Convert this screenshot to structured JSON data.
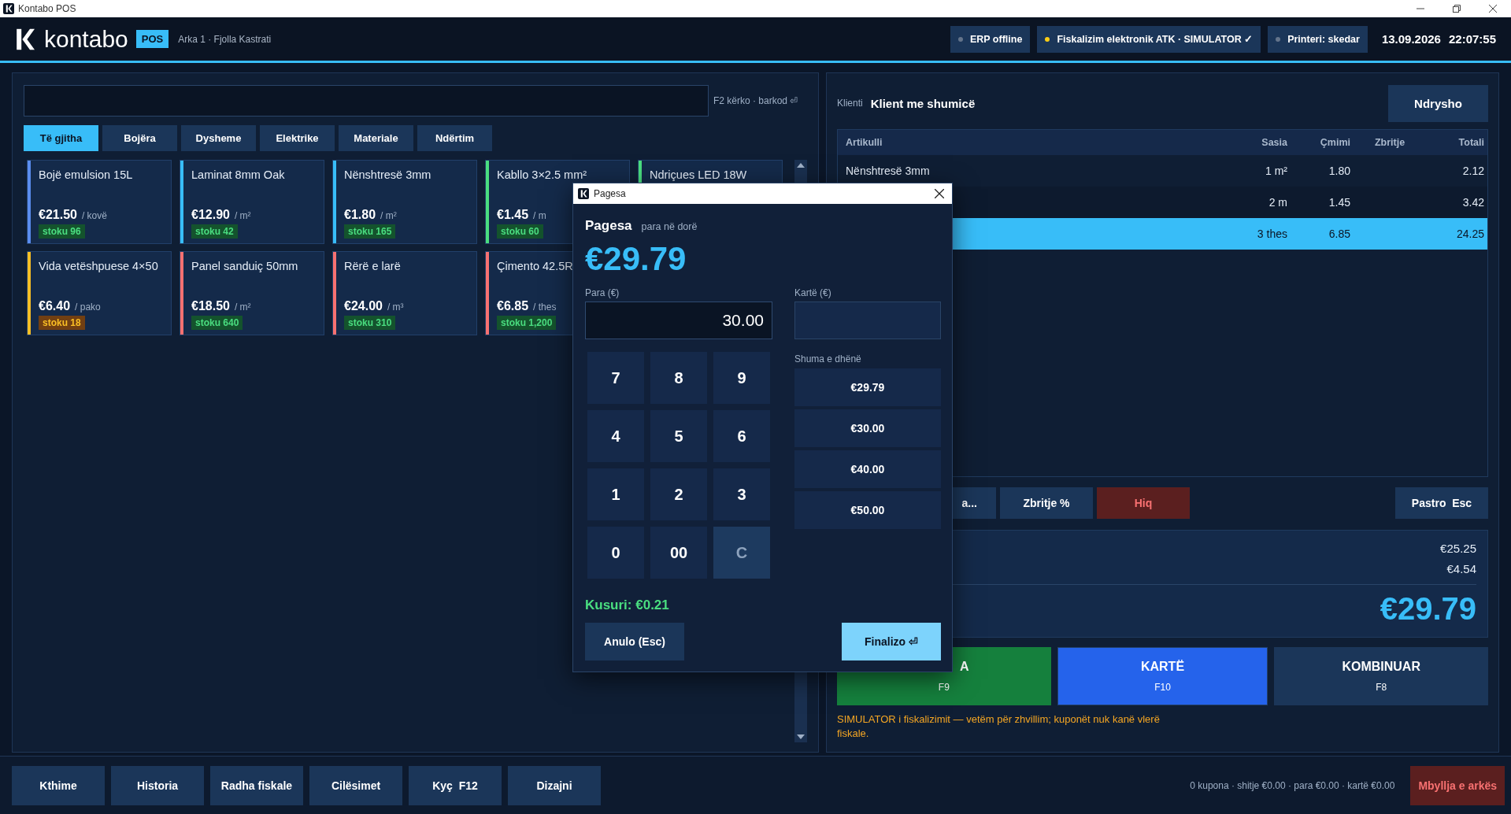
{
  "window": {
    "title": "Kontabo POS"
  },
  "header": {
    "logo": "kontabo",
    "badge": "POS",
    "register": "Arka 1 · Fjolla Kastrati",
    "status": [
      {
        "label": "ERP offline",
        "color": "#64748b"
      },
      {
        "label": "Fiskalizim elektronik ATK · SIMULATOR ✓",
        "color": "#facc15"
      },
      {
        "label": "Printeri: skedar",
        "color": "#64748b"
      }
    ],
    "date": "13.09.2026",
    "time": "22:07:55"
  },
  "search": {
    "shortcut_hint": "F2 kërko · barkod ⏎"
  },
  "categories": [
    {
      "label": "Të gjitha",
      "selected": true
    },
    {
      "label": "Bojëra",
      "selected": false
    },
    {
      "label": "Dysheme",
      "selected": false
    },
    {
      "label": "Elektrike",
      "selected": false
    },
    {
      "label": "Materiale",
      "selected": false
    },
    {
      "label": "Ndërtim",
      "selected": false
    }
  ],
  "products": [
    {
      "name": "Bojë emulsion 15L",
      "price": "€21.50",
      "unit": "/ kovë",
      "stock": "stoku 96",
      "low": false,
      "color": "#5b8def"
    },
    {
      "name": "Laminat 8mm Oak",
      "price": "€12.90",
      "unit": "/ m²",
      "stock": "stoku 42",
      "low": false,
      "color": "#38bdf8"
    },
    {
      "name": "Nënshtresë 3mm",
      "price": "€1.80",
      "unit": "/ m²",
      "stock": "stoku 165",
      "low": false,
      "color": "#38bdf8"
    },
    {
      "name": "Kabllo 3×2.5 mm²",
      "price": "€1.45",
      "unit": "/ m",
      "stock": "stoku 60",
      "low": false,
      "color": "#4ade80"
    },
    {
      "name": "Ndriçues LED 18W",
      "color": "#4ade80"
    },
    {
      "name": "Vida vetëshpuese 4×50",
      "price": "€6.40",
      "unit": "/ pako",
      "stock": "stoku 18",
      "low": true,
      "color": "#fbbf24"
    },
    {
      "name": "Panel sanduiç 50mm",
      "price": "€18.50",
      "unit": "/ m²",
      "stock": "stoku 640",
      "low": false,
      "color": "#f87171"
    },
    {
      "name": "Rërë e larë",
      "price": "€24.00",
      "unit": "/ m³",
      "stock": "stoku 310",
      "low": false,
      "color": "#f87171"
    },
    {
      "name": "Çimento 42.5R",
      "price": "€6.85",
      "unit": "/ thes",
      "stock": "stoku 1,200",
      "low": false,
      "color": "#f87171"
    }
  ],
  "cart": {
    "client_label": "Klienti",
    "client": "Klient me shumicë",
    "change_button": "Ndrysho",
    "columns": [
      "Artikulli",
      "Sasia",
      "Çmimi",
      "Zbritje",
      "Totali"
    ],
    "rows": [
      {
        "name": "Nënshtresë 3mm",
        "qty": "1 m²",
        "price": "1.80",
        "total": "2.12",
        "selected": false
      },
      {
        "qty": "2 m",
        "price": "1.45",
        "total": "3.42",
        "selected": false
      },
      {
        "qty": "3 thes",
        "price": "6.85",
        "total": "24.25",
        "selected": true
      }
    ]
  },
  "actions": [
    {
      "label": "a...",
      "kind": "partial"
    },
    {
      "label": "Zbritje %",
      "kind": "normal"
    },
    {
      "label": "Hiq",
      "kind": "danger"
    }
  ],
  "clear_button": "Pastro  Esc",
  "totals": {
    "line_1": "€25.25",
    "line_2": "€4.54",
    "total": "€29.79"
  },
  "payment_buttons": [
    {
      "label": "A",
      "shortcut": "F9",
      "kind": "cash"
    },
    {
      "label": "KARTË",
      "shortcut": "F10",
      "kind": "card"
    },
    {
      "label": "KOMBINUAR",
      "shortcut": "F8",
      "kind": "combined"
    }
  ],
  "notice": "SIMULATOR i fiskalizimit — vetëm për zhvillim; kuponët nuk kanë vlerë fiskale.",
  "footer": {
    "buttons": [
      "Kthime",
      "Historia",
      "Radha fiskale",
      "Cilësimet",
      "Kyç  F12",
      "Dizajni"
    ],
    "summary": "0 kupona · shitje €0.00 · para €0.00 · kartë €0.00",
    "close_button": "Mbyllja e arkës"
  },
  "dialog": {
    "title": "Pagesa",
    "heading": "Pagesa",
    "subheading": "para në dorë",
    "amount": "€29.79",
    "fields": [
      {
        "label": "Para (€)",
        "value": "30.00",
        "focused": true
      },
      {
        "label": "Kartë (€)",
        "focused": false
      }
    ],
    "keys": [
      {
        "label": "7",
        "kind": "digit"
      },
      {
        "label": "8",
        "kind": "digit"
      },
      {
        "label": "9",
        "kind": "digit"
      },
      {
        "label": "4",
        "kind": "digit"
      },
      {
        "label": "5",
        "kind": "digit"
      },
      {
        "label": "6",
        "kind": "digit"
      },
      {
        "label": "1",
        "kind": "digit"
      },
      {
        "label": "2",
        "kind": "digit"
      },
      {
        "label": "3",
        "kind": "digit"
      },
      {
        "label": "0",
        "kind": "digit"
      },
      {
        "label": "00",
        "kind": "digit"
      },
      {
        "label": "C",
        "kind": "clear"
      }
    ],
    "quick_label": "Shuma e dhënë",
    "quick_amounts": [
      "€29.79",
      "€30.00",
      "€40.00",
      "€50.00"
    ],
    "change": "Kusuri: €0.21",
    "cancel_button": "Anulo (Esc)",
    "confirm_button": "Finalizo ⏎"
  }
}
